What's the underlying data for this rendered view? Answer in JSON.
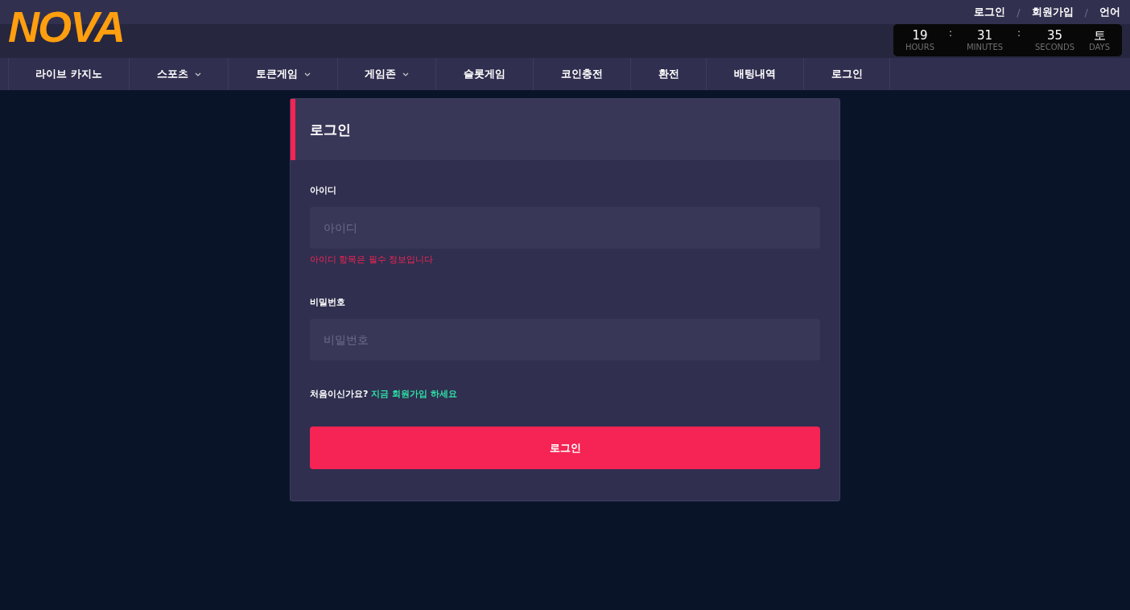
{
  "logo": {
    "text": "NOVA"
  },
  "top_links": [
    {
      "kind": "link",
      "text": "로그인"
    },
    {
      "kind": "separator",
      "text": "/"
    },
    {
      "kind": "link",
      "text": "회원가입"
    },
    {
      "kind": "separator",
      "text": "/"
    },
    {
      "kind": "link",
      "text": "언어"
    }
  ],
  "countdown": [
    {
      "kind": "unit",
      "value": "19",
      "unit": "HOURS"
    },
    {
      "kind": "separator",
      "text": ":"
    },
    {
      "kind": "unit",
      "value": "31",
      "unit": "MINUTES"
    },
    {
      "kind": "separator",
      "text": ":"
    },
    {
      "kind": "unit",
      "value": "35",
      "unit": "SECONDS"
    },
    {
      "kind": "unit",
      "value": "토",
      "unit": "DAYS"
    }
  ],
  "nav": [
    {
      "label": "라이브 카지노",
      "has_dropdown": false
    },
    {
      "label": "스포츠",
      "has_dropdown": true
    },
    {
      "label": "토큰게임",
      "has_dropdown": true
    },
    {
      "label": "게임존",
      "has_dropdown": true
    },
    {
      "label": "슬롯게임",
      "has_dropdown": false
    },
    {
      "label": "코인충전",
      "has_dropdown": false
    },
    {
      "label": "환전",
      "has_dropdown": false
    },
    {
      "label": "배팅내역",
      "has_dropdown": false
    },
    {
      "label": "로그인",
      "has_dropdown": false
    }
  ],
  "login": {
    "title": "로그인",
    "fields": [
      {
        "label": "아이디",
        "placeholder": "아이디",
        "error": "아이디 항목은 필수 정보입니다"
      },
      {
        "label": "비밀번호",
        "placeholder": "비밀번호"
      }
    ],
    "signup_prompt": "처음이신가요?",
    "signup_link": "지금 회원가입 하세요",
    "submit": "로그인"
  }
}
